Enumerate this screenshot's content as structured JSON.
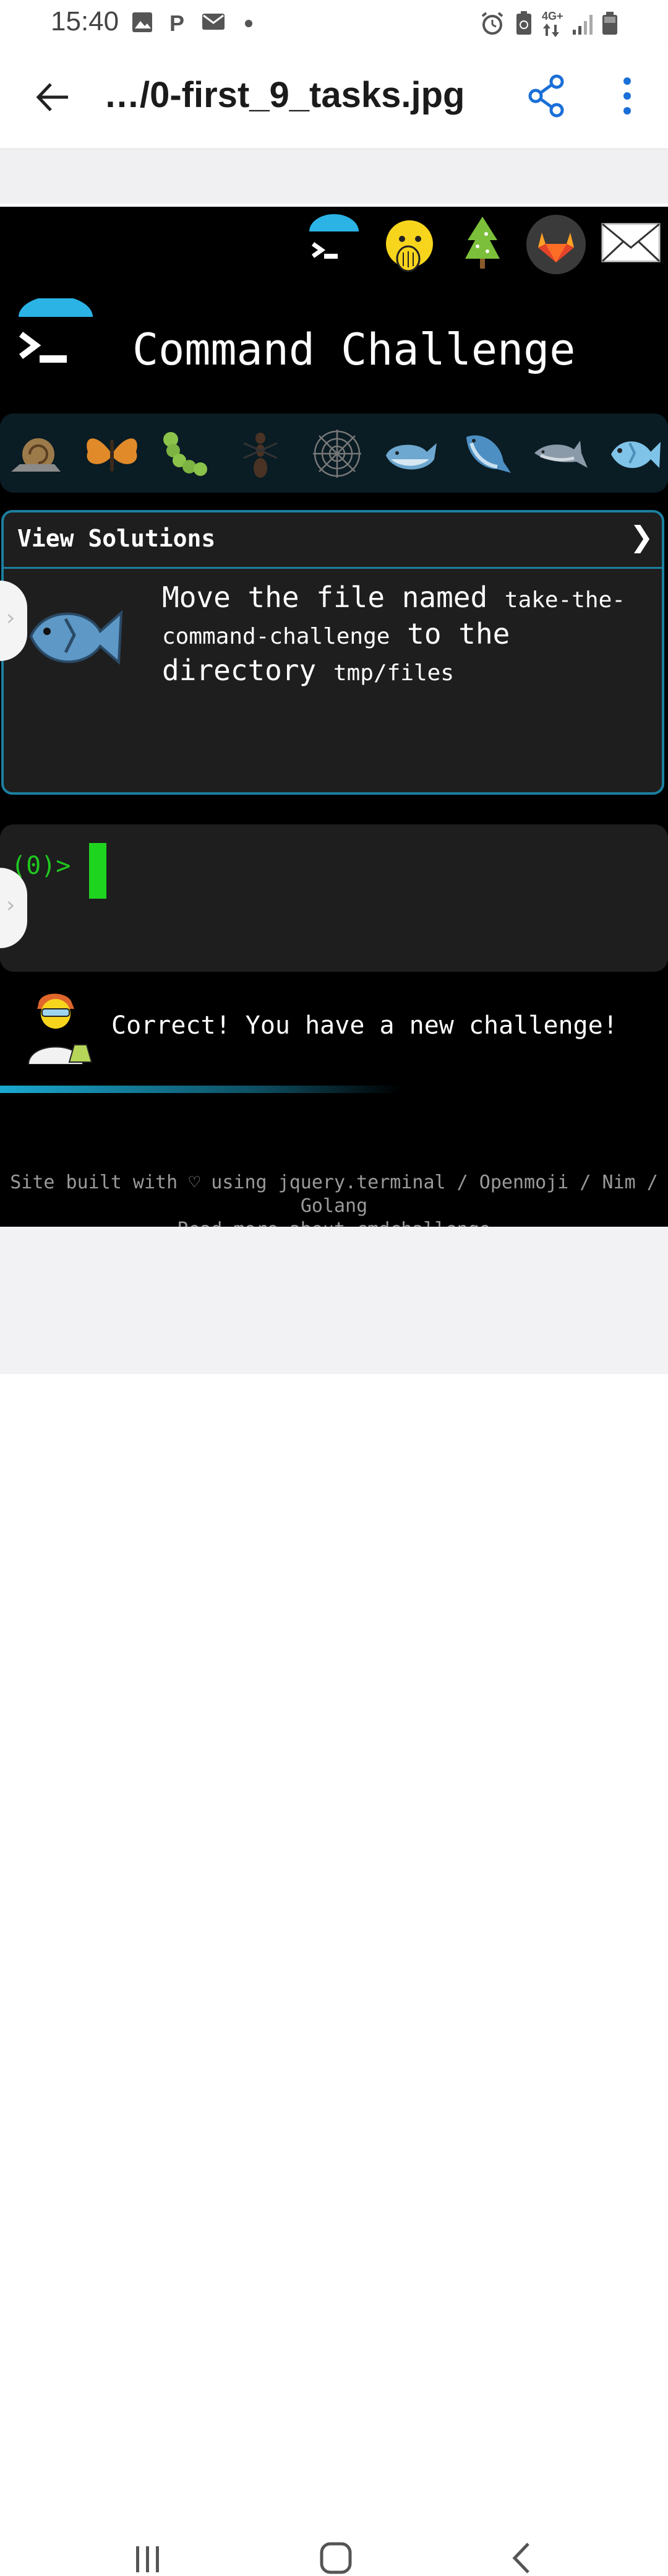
{
  "status": {
    "time": "15:40",
    "network": "4G+"
  },
  "app_bar": {
    "file_title": "…/0-first_9_tasks.jpg"
  },
  "site": {
    "title": "Command Challenge",
    "top_icons": [
      "terminal-umbrella-icon",
      "face-with-hand-over-mouth-icon",
      "tree-icon",
      "gitlab-icon",
      "mail-icon"
    ],
    "levels": [
      "snail-icon",
      "butterfly-icon",
      "caterpillar-icon",
      "ant-icon",
      "spider-web-icon",
      "whale-icon",
      "whale-jumping-icon",
      "dolphin-icon",
      "fish-icon"
    ],
    "task_header": "View Solutions",
    "task": {
      "part1": "Move the file named ",
      "code1": "take-the-command-challenge",
      "part2": " to the directory ",
      "code2": "tmp/files"
    },
    "prompt": "(0)>",
    "feedback": "Correct! You have a new challenge!",
    "footer_line1": "Site built with ♡ using jquery.terminal / Openmoji / Nim / Golang",
    "footer_line2": "Read more about cmdchallenge"
  },
  "colors": {
    "accent_blue": "#1c7fa0",
    "prompt_green": "#1fc81f",
    "share_blue": "#1a6fd8"
  }
}
